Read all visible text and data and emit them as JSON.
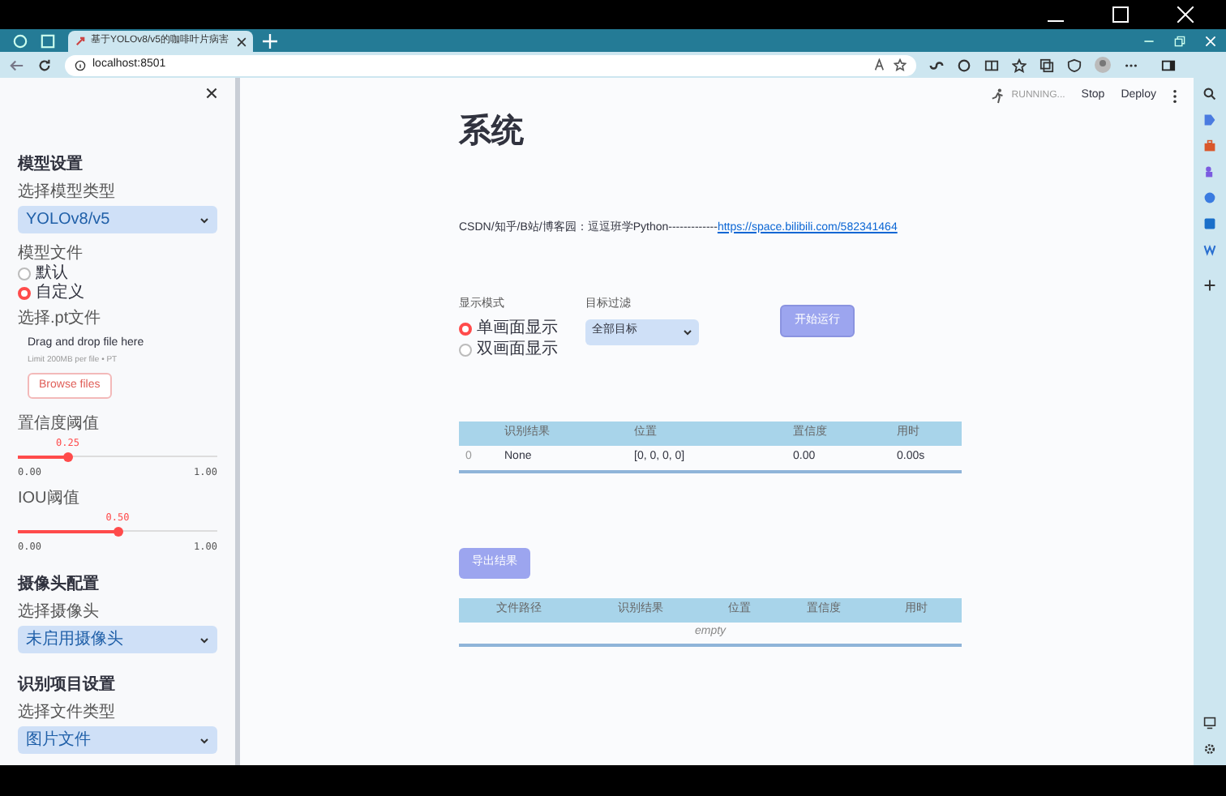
{
  "browser": {
    "tab_title": "基于YOLOv8/v5的咖啡叶片病害",
    "url": "localhost:8501"
  },
  "sidebar": {
    "items": [
      {
        "kind": "heading",
        "text": "模型设置"
      },
      {
        "kind": "select",
        "label": "选择模型类型",
        "value": "YOLOv8/v5"
      },
      {
        "kind": "radio",
        "label": "模型文件",
        "options": [
          {
            "label": "默认",
            "selected": false
          },
          {
            "label": "自定义",
            "selected": true
          }
        ]
      },
      {
        "kind": "uploader",
        "label": "选择.pt文件",
        "title": "Drag and drop file here",
        "hint": "Limit 200MB per file • PT",
        "button": "Browse files"
      },
      {
        "kind": "slider",
        "label": "置信度阈值",
        "reading": "0.25",
        "level": 0.25,
        "min": "0.00",
        "max": "1.00"
      },
      {
        "kind": "slider",
        "label": "IOU阈值",
        "reading": "0.50",
        "level": 0.5,
        "min": "0.00",
        "max": "1.00"
      },
      {
        "kind": "heading",
        "text": "摄像头配置"
      },
      {
        "kind": "select",
        "label": "选择摄像头",
        "value": "未启用摄像头"
      },
      {
        "kind": "heading",
        "text": "识别项目设置"
      },
      {
        "kind": "select",
        "label": "选择文件类型",
        "value": "图片文件"
      }
    ]
  },
  "header": {
    "status": "RUNNING...",
    "buttons": [
      "Stop",
      "Deploy"
    ]
  },
  "title": "系统",
  "intro": {
    "text": "CSDN/知乎/B站/博客园：逗逗班学Python-------------",
    "link": "https://space.bilibili.com/582341464"
  },
  "display_mode": {
    "label": "显示模式",
    "options": [
      {
        "label": "单画面显示",
        "selected": true
      },
      {
        "label": "双画面显示",
        "selected": false
      }
    ]
  },
  "target_filter": {
    "label": "目标过滤",
    "value": "全部目标"
  },
  "run_button": "开始运行",
  "results_table": {
    "columns": [
      "",
      "识别结果",
      "位置",
      "置信度",
      "用时"
    ],
    "rows": [
      [
        "0",
        "None",
        "[0, 0, 0, 0]",
        "0.00",
        "0.00s"
      ]
    ]
  },
  "export_button": "导出结果",
  "files_table": {
    "columns": [
      "文件路径",
      "识别结果",
      "位置",
      "置信度",
      "用时"
    ],
    "empty_text": "empty"
  }
}
